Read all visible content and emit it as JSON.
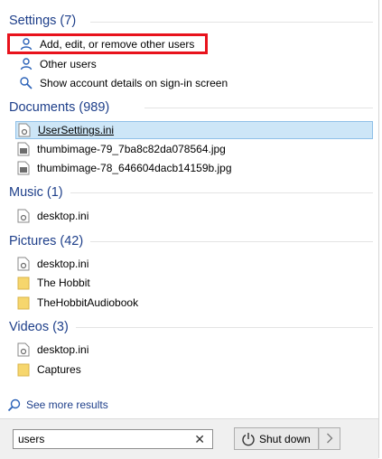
{
  "sections": {
    "settings": {
      "title": "Settings (7)",
      "items": [
        {
          "label": "Add, edit, or remove other users",
          "icon": "user-icon"
        },
        {
          "label": "Other users",
          "icon": "user-icon"
        },
        {
          "label": "Show account details on sign-in screen",
          "icon": "user-search-icon"
        }
      ]
    },
    "documents": {
      "title": "Documents (989)",
      "items": [
        {
          "label": "UserSettings.ini",
          "icon": "settings-file-icon",
          "selected": true
        },
        {
          "label": "thumbimage-79_7ba8c82da078564.jpg",
          "icon": "image-file-icon"
        },
        {
          "label": "thumbimage-78_646604dacb14159b.jpg",
          "icon": "image-file-icon"
        }
      ]
    },
    "music": {
      "title": "Music (1)",
      "items": [
        {
          "label": "desktop.ini",
          "icon": "settings-file-icon"
        }
      ]
    },
    "pictures": {
      "title": "Pictures (42)",
      "items": [
        {
          "label": "desktop.ini",
          "icon": "settings-file-icon"
        },
        {
          "label": "The Hobbit",
          "icon": "folder-icon"
        },
        {
          "label": "TheHobbitAudiobook",
          "icon": "folder-icon"
        }
      ]
    },
    "videos": {
      "title": "Videos (3)",
      "items": [
        {
          "label": "desktop.ini",
          "icon": "settings-file-icon"
        },
        {
          "label": "Captures",
          "icon": "folder-icon"
        }
      ]
    }
  },
  "see_more": {
    "label": "See more results",
    "icon": "search-icon"
  },
  "search": {
    "value": "users",
    "clear_icon": "close-icon"
  },
  "shutdown": {
    "label": "Shut down",
    "icon": "power-icon",
    "arrow_icon": "chevron-right-icon"
  },
  "colors": {
    "header": "#1e3f8a",
    "selection_bg": "#cde6f7",
    "selection_border": "#8fc0e8",
    "highlight_box": "#e8121c",
    "folder": "#f6d66d"
  }
}
